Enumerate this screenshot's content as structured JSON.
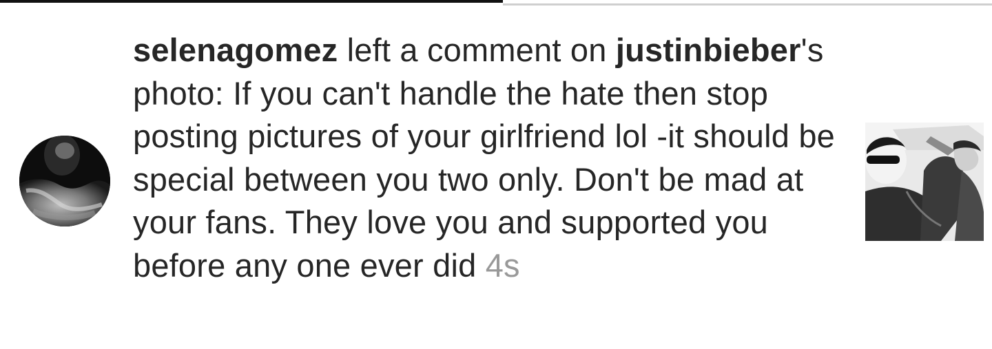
{
  "notification": {
    "actor_username": "selenagomez",
    "action_text": " left a comment on ",
    "target_username": "justinbieber",
    "target_suffix": "'s photo: ",
    "comment_text": "If you can't handle the hate then stop posting pictures of your girlfriend lol -it should be special between you two only. Don't be mad at your fans. They love you and supported you before any one ever did",
    "timestamp": "4s"
  },
  "tabs": {
    "active_color": "#111111",
    "inactive_color": "#cfcfcf"
  },
  "icons": {
    "avatar": "profile-avatar",
    "thumbnail": "post-thumbnail"
  }
}
